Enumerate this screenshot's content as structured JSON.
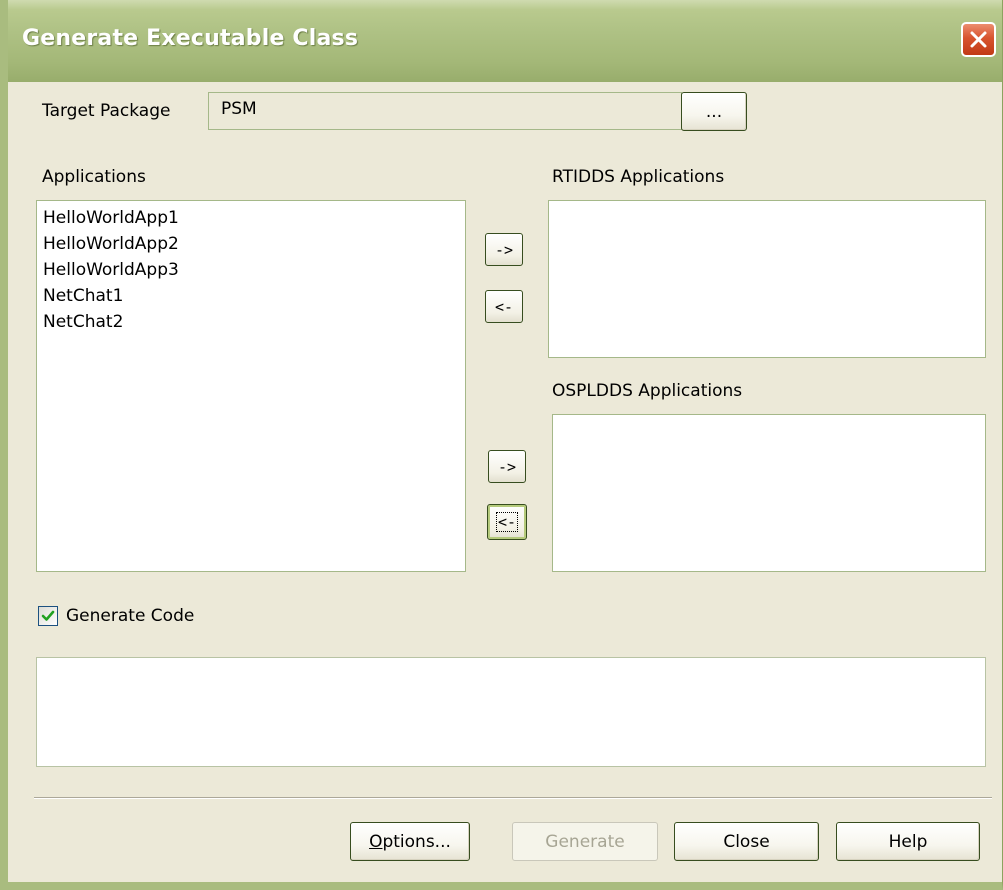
{
  "window": {
    "title": "Generate Executable Class"
  },
  "target": {
    "label": "Target Package",
    "value": "PSM",
    "browse_label": "..."
  },
  "applications": {
    "label": "Applications",
    "items": [
      "HelloWorldApp1",
      "HelloWorldApp2",
      "HelloWorldApp3",
      "NetChat1",
      "NetChat2"
    ]
  },
  "rtidds": {
    "label": "RTIDDS Applications",
    "add_label": "->",
    "remove_label": "<-"
  },
  "ospldds": {
    "label": "OSPLDDS Applications",
    "add_label": "->",
    "remove_label": "<-"
  },
  "generate_code": {
    "label": "Generate Code",
    "checked": true
  },
  "buttons": {
    "options_mnemonic": "O",
    "options_rest": "ptions...",
    "generate": "Generate",
    "close": "Close",
    "help": "Help"
  },
  "colors": {
    "titlebar": "#a4b878",
    "dialog_bg": "#ece9d8",
    "close_button": "#d8542f",
    "check_mark": "#21a121"
  },
  "icons": {
    "close": "close-x-icon",
    "checkbox": "check-icon"
  }
}
